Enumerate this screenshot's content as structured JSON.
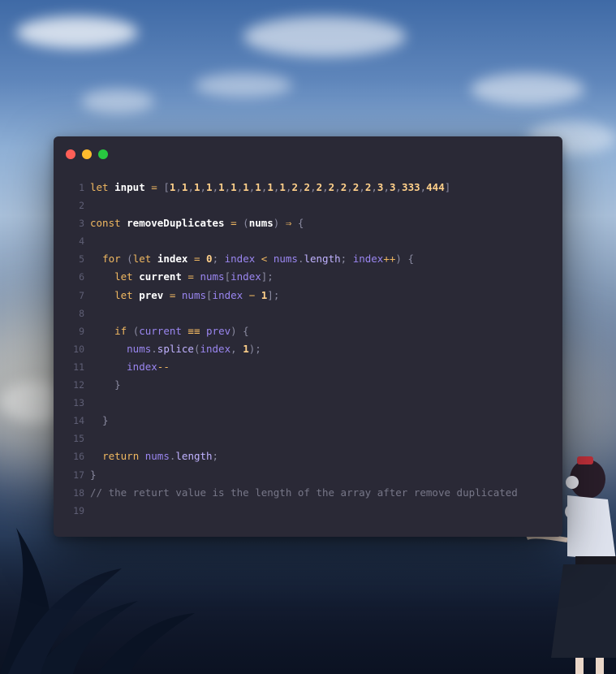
{
  "window": {
    "controls": [
      "close",
      "minimize",
      "maximize"
    ],
    "colors": {
      "close": "#ff5f57",
      "minimize": "#febc2e",
      "maximize": "#28c840",
      "background": "#2a2936"
    }
  },
  "code": {
    "language": "javascript",
    "lines": [
      {
        "n": "1",
        "tokens": [
          [
            "let ",
            "kw"
          ],
          [
            "input",
            "var"
          ],
          [
            " = ",
            "op"
          ],
          [
            "[",
            "pun"
          ],
          [
            "1",
            "num"
          ],
          [
            ",",
            "pun"
          ],
          [
            "1",
            "num"
          ],
          [
            ",",
            "pun"
          ],
          [
            "1",
            "num"
          ],
          [
            ",",
            "pun"
          ],
          [
            "1",
            "num"
          ],
          [
            ",",
            "pun"
          ],
          [
            "1",
            "num"
          ],
          [
            ",",
            "pun"
          ],
          [
            "1",
            "num"
          ],
          [
            ",",
            "pun"
          ],
          [
            "1",
            "num"
          ],
          [
            ",",
            "pun"
          ],
          [
            "1",
            "num"
          ],
          [
            ",",
            "pun"
          ],
          [
            "1",
            "num"
          ],
          [
            ",",
            "pun"
          ],
          [
            "1",
            "num"
          ],
          [
            ",",
            "pun"
          ],
          [
            "2",
            "num"
          ],
          [
            ",",
            "pun"
          ],
          [
            "2",
            "num"
          ],
          [
            ",",
            "pun"
          ],
          [
            "2",
            "num"
          ],
          [
            ",",
            "pun"
          ],
          [
            "2",
            "num"
          ],
          [
            ",",
            "pun"
          ],
          [
            "2",
            "num"
          ],
          [
            ",",
            "pun"
          ],
          [
            "2",
            "num"
          ],
          [
            ",",
            "pun"
          ],
          [
            "2",
            "num"
          ],
          [
            ",",
            "pun"
          ],
          [
            "3",
            "num"
          ],
          [
            ",",
            "pun"
          ],
          [
            "3",
            "num"
          ],
          [
            ",",
            "pun"
          ],
          [
            "333",
            "num"
          ],
          [
            ",",
            "pun"
          ],
          [
            "444",
            "num"
          ],
          [
            "]",
            "pun"
          ]
        ]
      },
      {
        "n": "2",
        "tokens": []
      },
      {
        "n": "3",
        "tokens": [
          [
            "const ",
            "kw"
          ],
          [
            "removeDuplicates",
            "var"
          ],
          [
            " = ",
            "op"
          ],
          [
            "(",
            "pun"
          ],
          [
            "nums",
            "var"
          ],
          [
            ")",
            "pun"
          ],
          [
            " ⇒ ",
            "op"
          ],
          [
            "{",
            "pun"
          ]
        ]
      },
      {
        "n": "4",
        "tokens": []
      },
      {
        "n": "5",
        "tokens": [
          [
            "  ",
            "pun"
          ],
          [
            "for ",
            "kw"
          ],
          [
            "(",
            "pun"
          ],
          [
            "let ",
            "kw"
          ],
          [
            "index",
            "var"
          ],
          [
            " = ",
            "op"
          ],
          [
            "0",
            "num"
          ],
          [
            "; ",
            "pun"
          ],
          [
            "index",
            "ref"
          ],
          [
            " < ",
            "op"
          ],
          [
            "nums",
            "ref"
          ],
          [
            ".",
            "pun"
          ],
          [
            "length",
            "pr"
          ],
          [
            "; ",
            "pun"
          ],
          [
            "index",
            "ref"
          ],
          [
            "++",
            "op"
          ],
          [
            ") {",
            "pun"
          ]
        ]
      },
      {
        "n": "6",
        "tokens": [
          [
            "    ",
            "pun"
          ],
          [
            "let ",
            "kw"
          ],
          [
            "current",
            "var"
          ],
          [
            " = ",
            "op"
          ],
          [
            "nums",
            "ref"
          ],
          [
            "[",
            "pun"
          ],
          [
            "index",
            "ref"
          ],
          [
            "];",
            "pun"
          ]
        ]
      },
      {
        "n": "7",
        "tokens": [
          [
            "    ",
            "pun"
          ],
          [
            "let ",
            "kw"
          ],
          [
            "prev",
            "var"
          ],
          [
            " = ",
            "op"
          ],
          [
            "nums",
            "ref"
          ],
          [
            "[",
            "pun"
          ],
          [
            "index",
            "ref"
          ],
          [
            " − ",
            "op"
          ],
          [
            "1",
            "num"
          ],
          [
            "];",
            "pun"
          ]
        ]
      },
      {
        "n": "8",
        "tokens": []
      },
      {
        "n": "9",
        "tokens": [
          [
            "    ",
            "pun"
          ],
          [
            "if ",
            "kw"
          ],
          [
            "(",
            "pun"
          ],
          [
            "current",
            "ref"
          ],
          [
            " ≡≡ ",
            "op"
          ],
          [
            "prev",
            "ref"
          ],
          [
            ") {",
            "pun"
          ]
        ]
      },
      {
        "n": "10",
        "tokens": [
          [
            "      ",
            "pun"
          ],
          [
            "nums",
            "ref"
          ],
          [
            ".",
            "pun"
          ],
          [
            "splice",
            "pr"
          ],
          [
            "(",
            "pun"
          ],
          [
            "index",
            "ref"
          ],
          [
            ", ",
            "pun"
          ],
          [
            "1",
            "num"
          ],
          [
            ");",
            "pun"
          ]
        ]
      },
      {
        "n": "11",
        "tokens": [
          [
            "      ",
            "pun"
          ],
          [
            "index",
            "ref"
          ],
          [
            "--",
            "op"
          ]
        ]
      },
      {
        "n": "12",
        "tokens": [
          [
            "    }",
            "pun"
          ]
        ]
      },
      {
        "n": "13",
        "tokens": []
      },
      {
        "n": "14",
        "tokens": [
          [
            "  }",
            "pun"
          ]
        ]
      },
      {
        "n": "15",
        "tokens": []
      },
      {
        "n": "16",
        "tokens": [
          [
            "  ",
            "pun"
          ],
          [
            "return ",
            "kw"
          ],
          [
            "nums",
            "ref"
          ],
          [
            ".",
            "pun"
          ],
          [
            "length",
            "pr"
          ],
          [
            ";",
            "pun"
          ]
        ]
      },
      {
        "n": "17",
        "tokens": [
          [
            "}",
            "pun"
          ]
        ]
      },
      {
        "n": "18",
        "tokens": [
          [
            "// the returt value is the length of the array after remove duplicated",
            "cm"
          ]
        ]
      },
      {
        "n": "19",
        "tokens": []
      }
    ]
  }
}
